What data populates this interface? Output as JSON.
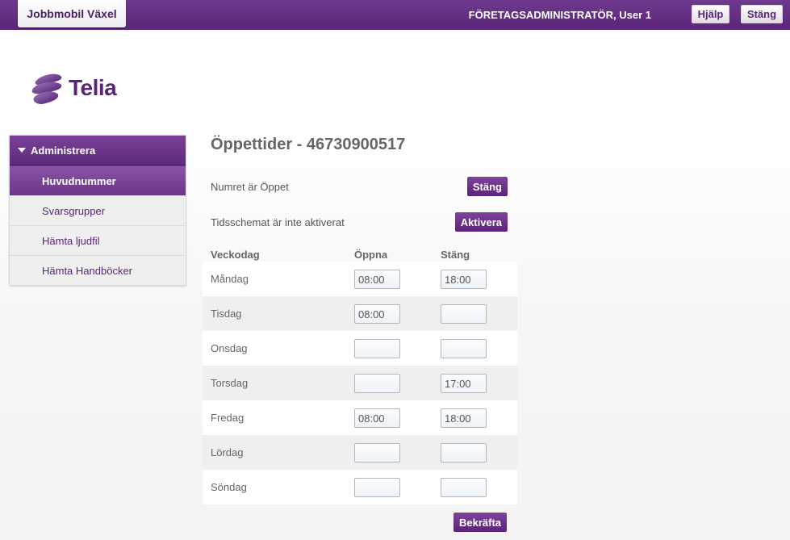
{
  "topbar": {
    "app_name": "Jobbmobil Växel",
    "user_label": "FÖRETAGSADMINISTRATÖR, User 1",
    "help_label": "Hjälp",
    "close_label": "Stäng"
  },
  "logo": {
    "text": "Telia"
  },
  "sidebar": {
    "header": "Administrera",
    "items": [
      {
        "label": "Huvudnummer",
        "active": true
      },
      {
        "label": "Svarsgrupper"
      },
      {
        "label": "Hämta ljudfil"
      },
      {
        "label": "Hämta Handböcker"
      }
    ]
  },
  "main": {
    "title": "Öppettider - 46730900517",
    "number_status": "Numret är Öppet",
    "number_button": "Stäng",
    "schedule_status": "Tidsschemat är inte aktiverat",
    "schedule_button": "Aktivera",
    "columns": {
      "day": "Veckodag",
      "open": "Öppna",
      "close": "Stäng"
    },
    "days": [
      {
        "day": "Måndag",
        "open": "08:00",
        "close": "18:00"
      },
      {
        "day": "Tisdag",
        "open": "08:00",
        "close": ""
      },
      {
        "day": "Onsdag",
        "open": "",
        "close": ""
      },
      {
        "day": "Torsdag",
        "open": "",
        "close": "17:00"
      },
      {
        "day": "Fredag",
        "open": "08:00",
        "close": "18:00"
      },
      {
        "day": "Lördag",
        "open": "",
        "close": ""
      },
      {
        "day": "Söndag",
        "open": "",
        "close": ""
      }
    ],
    "confirm_button": "Bekräfta"
  },
  "colors": {
    "brand": "#5a2477",
    "accent": "#7e449b"
  }
}
